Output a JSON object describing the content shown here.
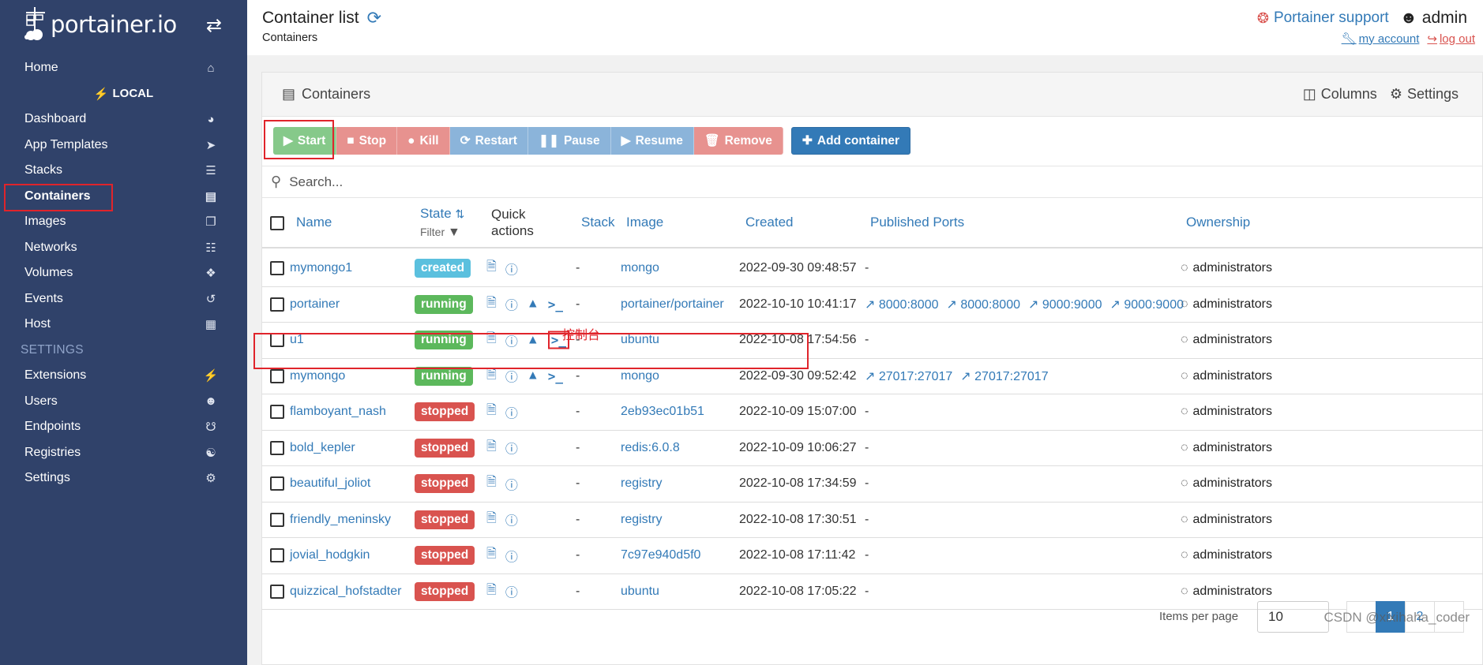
{
  "brand": {
    "name": "portainer.io"
  },
  "sidebar": {
    "home": "Home",
    "group": "LOCAL",
    "items": [
      {
        "label": "Dashboard",
        "icon": "tachometer-icon"
      },
      {
        "label": "App Templates",
        "icon": "rocket-icon"
      },
      {
        "label": "Stacks",
        "icon": "th-list-icon"
      },
      {
        "label": "Containers",
        "icon": "server-icon"
      },
      {
        "label": "Images",
        "icon": "clone-icon"
      },
      {
        "label": "Networks",
        "icon": "sitemap-icon"
      },
      {
        "label": "Volumes",
        "icon": "cubes-icon"
      },
      {
        "label": "Events",
        "icon": "history-icon"
      },
      {
        "label": "Host",
        "icon": "th-icon"
      }
    ],
    "settings_section": "SETTINGS",
    "settings_items": [
      {
        "label": "Extensions",
        "icon": "bolt-icon"
      },
      {
        "label": "Users",
        "icon": "users-icon"
      },
      {
        "label": "Endpoints",
        "icon": "plug-icon"
      },
      {
        "label": "Registries",
        "icon": "database-icon"
      },
      {
        "label": "Settings",
        "icon": "cogs-icon"
      }
    ]
  },
  "header": {
    "title": "Container list",
    "breadcrumb": "Containers",
    "support": "Portainer support",
    "user": "admin",
    "my_account": "my account",
    "log_out": "log out"
  },
  "panel": {
    "title": "Containers",
    "columns": "Columns",
    "settings": "Settings"
  },
  "toolbar": {
    "start": "Start",
    "stop": "Stop",
    "kill": "Kill",
    "restart": "Restart",
    "pause": "Pause",
    "resume": "Resume",
    "remove": "Remove",
    "add": "Add container"
  },
  "search": {
    "placeholder": "Search..."
  },
  "table": {
    "headers": {
      "name": "Name",
      "state": "State",
      "filter": "Filter",
      "quick_actions_1": "Quick",
      "quick_actions_2": "actions",
      "stack": "Stack",
      "image": "Image",
      "created": "Created",
      "ports": "Published Ports",
      "ownership": "Ownership"
    },
    "console_annotation": "控制台",
    "rows": [
      {
        "name": "mymongo1",
        "state": "created",
        "stack": "-",
        "image": "mongo",
        "created": "2022-09-30 09:48:57",
        "ports": [],
        "ownership": "administrators"
      },
      {
        "name": "portainer",
        "state": "running",
        "stack": "-",
        "image": "portainer/portainer",
        "created": "2022-10-10 10:41:17",
        "ports": [
          "8000:8000",
          "8000:8000",
          "9000:9000",
          "9000:9000"
        ],
        "ownership": "administrators"
      },
      {
        "name": "u1",
        "state": "running",
        "stack": "-",
        "image": "ubuntu",
        "created": "2022-10-08 17:54:56",
        "ports": [],
        "ownership": "administrators"
      },
      {
        "name": "mymongo",
        "state": "running",
        "stack": "-",
        "image": "mongo",
        "created": "2022-09-30 09:52:42",
        "ports": [
          "27017:27017",
          "27017:27017"
        ],
        "ownership": "administrators"
      },
      {
        "name": "flamboyant_nash",
        "state": "stopped",
        "stack": "-",
        "image": "2eb93ec01b51",
        "created": "2022-10-09 15:07:00",
        "ports": [],
        "ownership": "administrators"
      },
      {
        "name": "bold_kepler",
        "state": "stopped",
        "stack": "-",
        "image": "redis:6.0.8",
        "created": "2022-10-09 10:06:27",
        "ports": [],
        "ownership": "administrators"
      },
      {
        "name": "beautiful_joliot",
        "state": "stopped",
        "stack": "-",
        "image": "registry",
        "created": "2022-10-08 17:34:59",
        "ports": [],
        "ownership": "administrators"
      },
      {
        "name": "friendly_meninsky",
        "state": "stopped",
        "stack": "-",
        "image": "registry",
        "created": "2022-10-08 17:30:51",
        "ports": [],
        "ownership": "administrators"
      },
      {
        "name": "jovial_hodgkin",
        "state": "stopped",
        "stack": "-",
        "image": "7c97e940d5f0",
        "created": "2022-10-08 17:11:42",
        "ports": [],
        "ownership": "administrators"
      },
      {
        "name": "quizzical_hofstadter",
        "state": "stopped",
        "stack": "-",
        "image": "ubuntu",
        "created": "2022-10-08 17:05:22",
        "ports": [],
        "ownership": "administrators"
      }
    ],
    "no_ports": "-"
  },
  "pagination": {
    "items_per_page_label": "Items per page",
    "items_per_page": "10",
    "pages": [
      "1",
      "2"
    ],
    "current": "1"
  },
  "watermark": "CSDN @xixihaha_coder",
  "colors": {
    "sidebar_bg": "#30426a",
    "accent": "#337ab7",
    "created": "#5bc0de",
    "running": "#5cb85c",
    "stopped": "#d9534f",
    "annotation": "#e0242b"
  }
}
